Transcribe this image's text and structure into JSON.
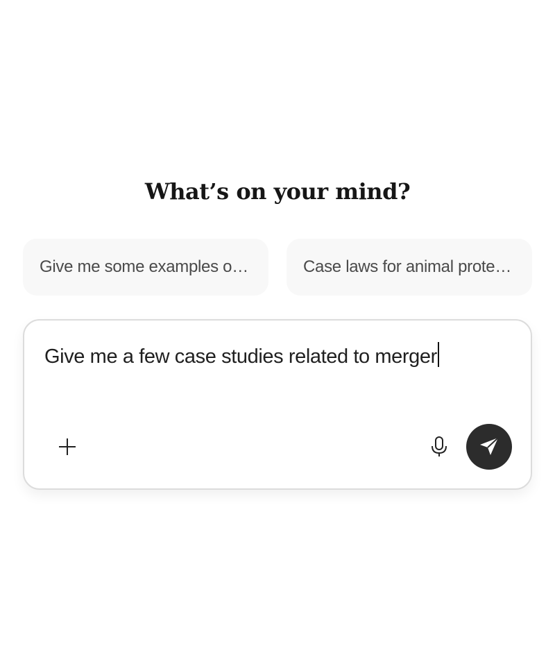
{
  "heading": "What’s on your mind?",
  "suggestions": [
    {
      "label": "Give me some examples of merger case studies"
    },
    {
      "label": "Case laws for animal protection"
    }
  ],
  "composer": {
    "input_value": "Give me a few case studies related to merger"
  },
  "icons": {
    "attach": "plus-icon",
    "voice": "microphone-icon",
    "send": "send-icon"
  },
  "colors": {
    "background": "#ffffff",
    "suggestion_bg": "#f8f8f8",
    "send_button": "#2c2c2c"
  }
}
